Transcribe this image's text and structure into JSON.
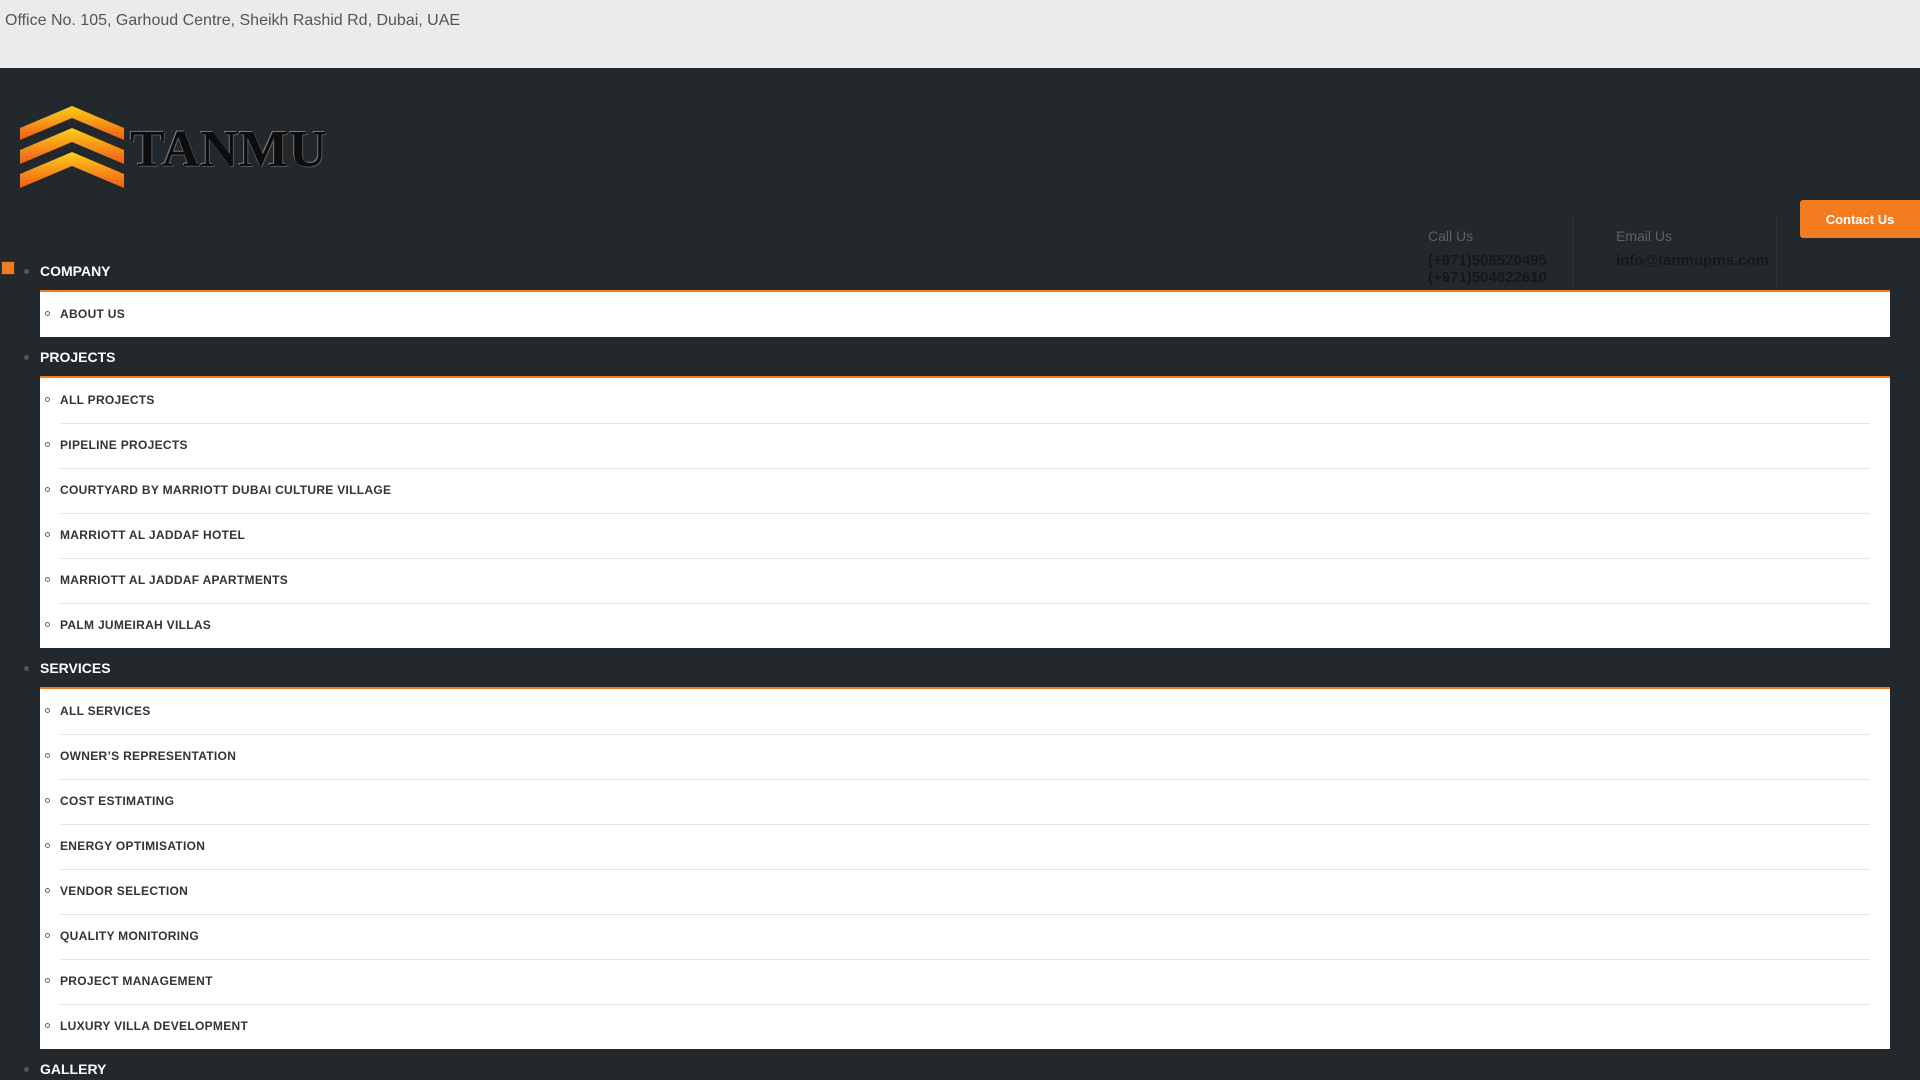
{
  "topbar": {
    "address": "Office No. 105, Garhoud Centre, Sheikh Rashid Rd, Dubai, UAE"
  },
  "brand": {
    "logo_text": "TANMU"
  },
  "contact": {
    "call_label": "Call Us",
    "phone_1": "(+971)506520495",
    "phone_2": "(+971)504822610",
    "email_label": "Email Us",
    "email": "info@tanmupms.com",
    "button_label": "Contact Us"
  },
  "menu": {
    "company": {
      "label": "COMPANY",
      "items": [
        "ABOUT US"
      ]
    },
    "projects": {
      "label": "PROJECTS",
      "items": [
        "ALL PROJECTS",
        "PIPELINE PROJECTS",
        "COURTYARD BY MARRIOTT DUBAI CULTURE VILLAGE",
        "MARRIOTT AL JADDAF HOTEL",
        "MARRIOTT AL JADDAF APARTMENTS",
        "PALM JUMEIRAH VILLAS"
      ]
    },
    "services": {
      "label": "SERVICES",
      "items": [
        "ALL SERVICES",
        "OWNER’S REPRESENTATION",
        "COST ESTIMATING",
        "ENERGY OPTIMISATION",
        "VENDOR SELECTION",
        "QUALITY MONITORING",
        "PROJECT MANAGEMENT",
        "LUXURY VILLA DEVELOPMENT"
      ]
    },
    "gallery": {
      "label": "GALLERY"
    }
  },
  "colors": {
    "accent": "#f47c20",
    "header_bg": "#23282d",
    "topbar_bg": "#ebebeb"
  }
}
